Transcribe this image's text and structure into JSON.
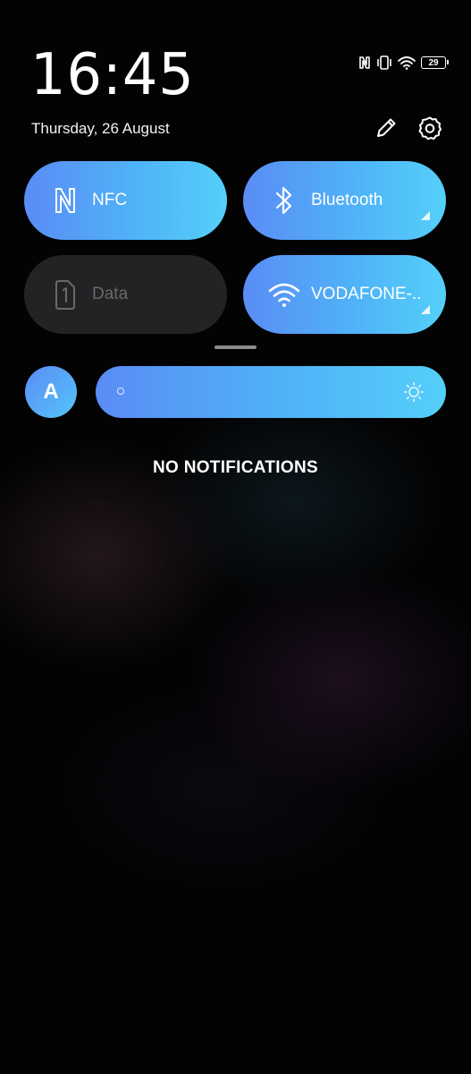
{
  "status_bar": {
    "time": "16:45",
    "date": "Thursday, 26 August",
    "battery_level": "29",
    "icons": [
      "nfc-icon",
      "vibrate-icon",
      "wifi-icon",
      "battery-icon"
    ]
  },
  "header_actions": {
    "icons": [
      "edit-icon",
      "settings-icon"
    ]
  },
  "quick_tiles": [
    {
      "label": "NFC",
      "icon": "nfc-icon",
      "active": true
    },
    {
      "label": "Bluetooth",
      "icon": "bluetooth-icon",
      "active": true
    },
    {
      "label": "Data",
      "icon": "sim-card-icon",
      "active": false
    },
    {
      "label": "VODAFONE-..",
      "icon": "wifi-icon",
      "active": true
    }
  ],
  "brightness": {
    "auto_label": "A",
    "level": 1.0,
    "icons": [
      "brightness-low-icon",
      "brightness-high-icon"
    ]
  },
  "notifications": {
    "empty_text": "NO NOTIFICATIONS"
  },
  "colors": {
    "tile_active_start": "#5a8cf5",
    "tile_active_end": "#55cff9",
    "tile_inactive": "#232325",
    "background": "#030304"
  }
}
